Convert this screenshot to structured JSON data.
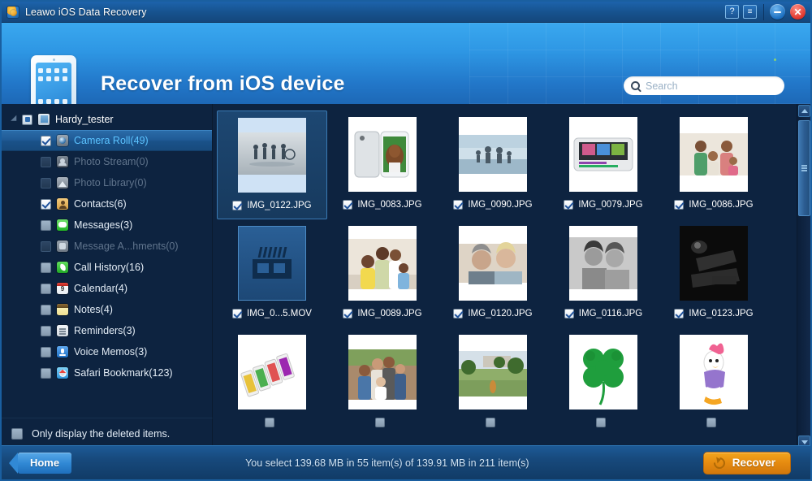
{
  "window": {
    "title": "Leawo iOS Data Recovery",
    "controls": {
      "help_label": "?",
      "menu_label": "≡",
      "minimize_label": "",
      "close_label": "✕"
    }
  },
  "header": {
    "title": "Recover from iOS device",
    "device_icon": "ipad-icon",
    "search": {
      "placeholder": "Search",
      "value": "",
      "icon": "search-icon"
    }
  },
  "sidebar": {
    "root": {
      "label": "Hardy_tester",
      "icon": "phone-icon",
      "expanded": true,
      "checkbox": "partial"
    },
    "items": [
      {
        "label": "Camera Roll(49)",
        "icon": "camera",
        "checked": true,
        "disabled": false,
        "selected": true
      },
      {
        "label": "Photo Stream(0)",
        "icon": "stream",
        "checked": false,
        "disabled": true,
        "selected": false
      },
      {
        "label": "Photo Library(0)",
        "icon": "library",
        "checked": false,
        "disabled": true,
        "selected": false
      },
      {
        "label": "Contacts(6)",
        "icon": "contacts",
        "checked": true,
        "disabled": false,
        "selected": false
      },
      {
        "label": "Messages(3)",
        "icon": "messages",
        "checked": false,
        "disabled": false,
        "selected": false
      },
      {
        "label": "Message A...hments(0)",
        "icon": "attach",
        "checked": false,
        "disabled": true,
        "selected": false
      },
      {
        "label": "Call History(16)",
        "icon": "call",
        "checked": false,
        "disabled": false,
        "selected": false
      },
      {
        "label": "Calendar(4)",
        "icon": "calendar",
        "checked": false,
        "disabled": false,
        "selected": false
      },
      {
        "label": "Notes(4)",
        "icon": "notes",
        "checked": false,
        "disabled": false,
        "selected": false
      },
      {
        "label": "Reminders(3)",
        "icon": "reminders",
        "checked": false,
        "disabled": false,
        "selected": false
      },
      {
        "label": "Voice Memos(3)",
        "icon": "voice",
        "checked": false,
        "disabled": false,
        "selected": false
      },
      {
        "label": "Safari Bookmark(123)",
        "icon": "safari",
        "checked": false,
        "disabled": false,
        "selected": false
      }
    ],
    "only_deleted": {
      "label": "Only display the deleted items.",
      "checked": false
    }
  },
  "grid": {
    "rows": [
      [
        {
          "name": "IMG_0122.JPG",
          "checked": true,
          "selected": true,
          "kind": "photo",
          "thumb": "bikes-silhouette"
        },
        {
          "name": "IMG_0083.JPG",
          "checked": true,
          "selected": false,
          "kind": "photo",
          "thumb": "iphone-woman"
        },
        {
          "name": "IMG_0090.JPG",
          "checked": true,
          "selected": false,
          "kind": "photo",
          "thumb": "beach-family"
        },
        {
          "name": "IMG_0079.JPG",
          "checked": true,
          "selected": false,
          "kind": "photo",
          "thumb": "ipod-video"
        },
        {
          "name": "IMG_0086.JPG",
          "checked": true,
          "selected": false,
          "kind": "photo",
          "thumb": "family-portrait"
        }
      ],
      [
        {
          "name": "IMG_0...5.MOV",
          "checked": true,
          "selected": false,
          "kind": "movie",
          "thumb": "film-reel"
        },
        {
          "name": "IMG_0089.JPG",
          "checked": true,
          "selected": false,
          "kind": "photo",
          "thumb": "family-couch"
        },
        {
          "name": "IMG_0120.JPG",
          "checked": true,
          "selected": false,
          "kind": "photo",
          "thumb": "senior-couple"
        },
        {
          "name": "IMG_0116.JPG",
          "checked": true,
          "selected": false,
          "kind": "photo",
          "thumb": "two-women-bw"
        },
        {
          "name": "IMG_0123.JPG",
          "checked": true,
          "selected": false,
          "kind": "photo",
          "thumb": "concert-dark"
        }
      ],
      [
        {
          "name": "",
          "checked": false,
          "selected": false,
          "kind": "photo",
          "thumb": "phones-colorful"
        },
        {
          "name": "",
          "checked": false,
          "selected": false,
          "kind": "photo",
          "thumb": "family-fence"
        },
        {
          "name": "",
          "checked": false,
          "selected": false,
          "kind": "photo",
          "thumb": "park-monument"
        },
        {
          "name": "",
          "checked": false,
          "selected": false,
          "kind": "photo",
          "thumb": "four-leaf-clover"
        },
        {
          "name": "",
          "checked": false,
          "selected": false,
          "kind": "photo",
          "thumb": "daisy-duck"
        }
      ]
    ]
  },
  "scrollbar": {
    "up_icon": "chevron-up-icon",
    "down_icon": "chevron-down-icon"
  },
  "statusbar": {
    "home_label": "Home",
    "status_text": "You select 139.68 MB in 55 item(s) of 139.91 MB in 211 item(s)",
    "recover_label": "Recover",
    "recover_icon": "restore-icon"
  },
  "colors": {
    "accent_blue": "#2e97e4",
    "selection_text": "#5cc3ff",
    "recover_orange": "#e58a10",
    "panel_dark": "#0d2340"
  }
}
